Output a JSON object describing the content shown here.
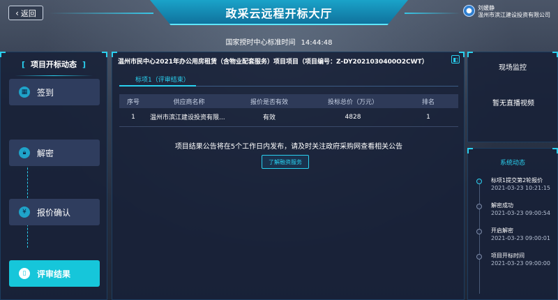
{
  "header": {
    "back_label": "返回",
    "title": "政采云远程开标大厅",
    "user_name": "刘媛静",
    "user_company": "温州市滨江建设投资有限公司",
    "time_label": "国家授时中心标准时间",
    "time_value": "14:44:48"
  },
  "left": {
    "title": "项目开标动态",
    "steps": [
      {
        "label": "签到",
        "icon": "calendar-icon",
        "active": false
      },
      {
        "label": "解密",
        "icon": "lock-icon",
        "active": false
      },
      {
        "label": "报价确认",
        "icon": "yen-icon",
        "active": false
      },
      {
        "label": "评审结果",
        "icon": "document-icon",
        "active": true
      }
    ]
  },
  "center": {
    "project_title": "温州市民中心2021年办公用房租赁（含物业配套服务）项目项目（项目编号：Z-DY2021030400O2CWT）",
    "lot_tab": "标项1（评审结束）",
    "table": {
      "columns": [
        "序号",
        "供应商名称",
        "报价是否有效",
        "投标总价（万元）",
        "排名"
      ],
      "rows": [
        [
          "1",
          "温州市滨江建设投资有限...",
          "有效",
          "4828",
          "1"
        ]
      ]
    },
    "notice": "项目结果公告将在5个工作日内发布，请及时关注政府采购网查看相关公告",
    "service_button": "了解融资服务"
  },
  "right": {
    "monitor_title": "现场监控",
    "monitor_empty": "暂无直播视频",
    "system_title": "系统动态",
    "events": [
      {
        "label": "标项1提交第2轮报价",
        "time": "2021-03-23 10:21:15"
      },
      {
        "label": "解密成功",
        "time": "2021-03-23 09:00:54"
      },
      {
        "label": "开启解密",
        "time": "2021-03-23 09:00:01"
      },
      {
        "label": "项目开标时间",
        "time": "2021-03-23 09:00:00"
      }
    ]
  },
  "colors": {
    "accent": "#2ad1f0",
    "active_step": "#16c6da",
    "panel_bg": "#182138"
  }
}
